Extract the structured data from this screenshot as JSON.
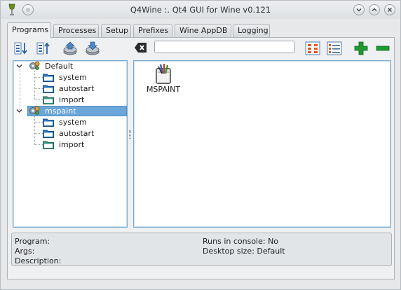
{
  "window": {
    "title": "Q4Wine :. Qt4 GUI for Wine v0.121"
  },
  "tabs": [
    {
      "label": "Programs",
      "active": true
    },
    {
      "label": "Processes",
      "active": false
    },
    {
      "label": "Setup",
      "active": false
    },
    {
      "label": "Prefixes",
      "active": false
    },
    {
      "label": "Wine AppDB",
      "active": false
    },
    {
      "label": "Logging",
      "active": false
    }
  ],
  "toolbar": {
    "search": {
      "value": "",
      "placeholder": ""
    },
    "icons": [
      "expand-all-icon",
      "collapse-all-icon",
      "import-icon",
      "export-icon",
      "clear-search-icon",
      "icon-view-icon",
      "list-view-icon",
      "add-icon",
      "remove-icon"
    ]
  },
  "tree": {
    "prefixes": [
      {
        "name": "Default",
        "expanded": true,
        "selected": false,
        "children": [
          "system",
          "autostart",
          "import"
        ]
      },
      {
        "name": "mspaint",
        "expanded": true,
        "selected": true,
        "children": [
          "system",
          "autostart",
          "import"
        ]
      }
    ]
  },
  "programs": [
    {
      "name": "MSPAINT",
      "icon": "paint-brush-icon"
    }
  ],
  "info": {
    "program_label": "Program:",
    "args_label": "Args:",
    "description_label": "Description:",
    "runs_in_console": "Runs in console: No",
    "desktop_size": "Desktop size: Default"
  },
  "colors": {
    "selection": "#6aa6d8",
    "pane_border": "#7fa9cc",
    "folder_blue": "#2f78c4",
    "folder_green": "#3f9a86",
    "add_green": "#1e9a2e"
  }
}
